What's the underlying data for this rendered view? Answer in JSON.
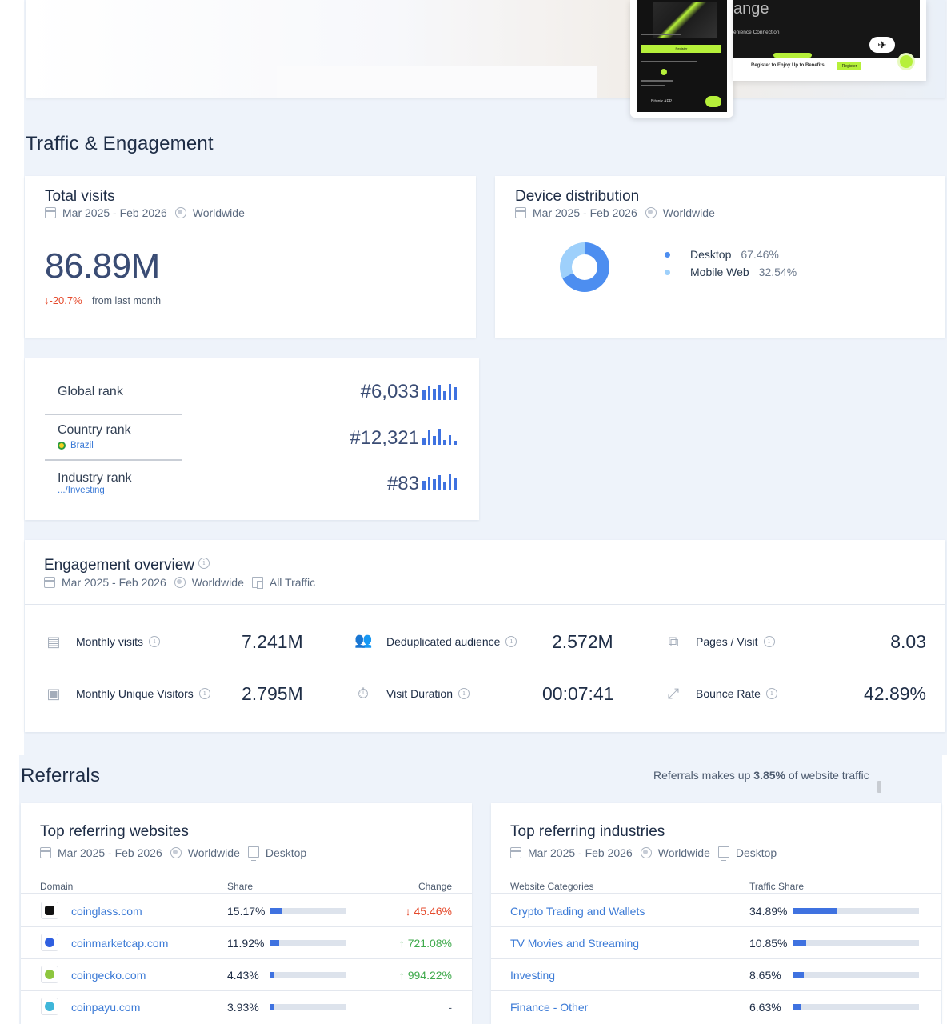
{
  "hero": {
    "laptop_title": "ange",
    "laptop_subtitle": "enience Connection",
    "laptop_footer": "Register to Enjoy Up to        Benefits",
    "laptop_register": "Register",
    "phone_register": "Register",
    "phone_app_label": "Bitunix APP"
  },
  "traffic": {
    "section_title": "Traffic & Engagement",
    "total_visits": {
      "title": "Total visits",
      "date_range": "Mar 2025 - Feb 2026",
      "region": "Worldwide",
      "value": "86.89M",
      "change": "↓-20.7%",
      "change_note": "from last month"
    },
    "device": {
      "title": "Device distribution",
      "date_range": "Mar 2025 - Feb 2026",
      "region": "Worldwide",
      "items": [
        {
          "label": "Desktop",
          "value": "67.46%",
          "share": 0.6746,
          "color": "#4d8ef0"
        },
        {
          "label": "Mobile Web",
          "value": "32.54%",
          "share": 0.3254,
          "color": "#9ed0fb"
        }
      ]
    },
    "ranks": [
      {
        "label": "Global rank",
        "sub": "",
        "value": "#6,033",
        "bars": [
          0.6,
          0.85,
          0.7,
          0.95,
          0.55,
          1.0,
          0.8
        ]
      },
      {
        "label": "Country rank",
        "sub": "Brazil",
        "value": "#12,321",
        "bars": [
          0.45,
          0.9,
          0.55,
          1.0,
          0.3,
          0.6,
          0.25
        ]
      },
      {
        "label": "Industry rank",
        "sub": ".../Investing",
        "value": "#83",
        "bars": [
          0.6,
          0.85,
          0.7,
          0.95,
          0.55,
          1.0,
          0.8
        ]
      }
    ]
  },
  "engagement": {
    "title": "Engagement overview",
    "date_range": "Mar 2025 - Feb 2026",
    "region": "Worldwide",
    "traffic": "All Traffic",
    "metrics": [
      {
        "label": "Monthly visits",
        "value": "7.241M",
        "icon": "calendar-icon"
      },
      {
        "label": "Deduplicated audience",
        "value": "2.572M",
        "icon": "people-icon"
      },
      {
        "label": "Pages / Visit",
        "value": "8.03",
        "icon": "pages-icon"
      },
      {
        "label": "Monthly Unique Visitors",
        "value": "2.795M",
        "icon": "visitor-card-icon"
      },
      {
        "label": "Visit Duration",
        "value": "00:07:41",
        "icon": "stopwatch-icon"
      },
      {
        "label": "Bounce Rate",
        "value": "42.89%",
        "icon": "bounce-arrow-icon"
      }
    ]
  },
  "referrals": {
    "section_title": "Referrals",
    "note_prefix": "Referrals makes up ",
    "note_value": "3.85%",
    "note_suffix": " of website traffic",
    "websites": {
      "title": "Top referring websites",
      "date_range": "Mar 2025 - Feb 2026",
      "region": "Worldwide",
      "device": "Desktop",
      "col_domain": "Domain",
      "col_share": "Share",
      "col_change": "Change",
      "rows": [
        {
          "domain": "coinglass.com",
          "share": "15.17%",
          "share_frac": 0.1517,
          "change": "↓ 45.46%",
          "dir": "down",
          "fav_color": "#111111"
        },
        {
          "domain": "coinmarketcap.com",
          "share": "11.92%",
          "share_frac": 0.1192,
          "change": "↑ 721.08%",
          "dir": "up",
          "fav_color": "#2f5fe0"
        },
        {
          "domain": "coingecko.com",
          "share": "4.43%",
          "share_frac": 0.0443,
          "change": "↑ 994.22%",
          "dir": "up",
          "fav_color": "#8dc63f"
        },
        {
          "domain": "coinpayu.com",
          "share": "3.93%",
          "share_frac": 0.0393,
          "change": "-",
          "dir": "flat",
          "fav_color": "#3fb6d9"
        }
      ]
    },
    "industries": {
      "title": "Top referring industries",
      "date_range": "Mar 2025 - Feb 2026",
      "region": "Worldwide",
      "device": "Desktop",
      "col_category": "Website Categories",
      "col_share": "Traffic Share",
      "rows": [
        {
          "category": "Crypto Trading and Wallets",
          "share": "34.89%",
          "share_frac": 0.3489
        },
        {
          "category": "TV Movies and Streaming",
          "share": "10.85%",
          "share_frac": 0.1085
        },
        {
          "category": "Investing",
          "share": "8.65%",
          "share_frac": 0.0865
        },
        {
          "category": "Finance - Other",
          "share": "6.63%",
          "share_frac": 0.0663
        }
      ]
    }
  }
}
